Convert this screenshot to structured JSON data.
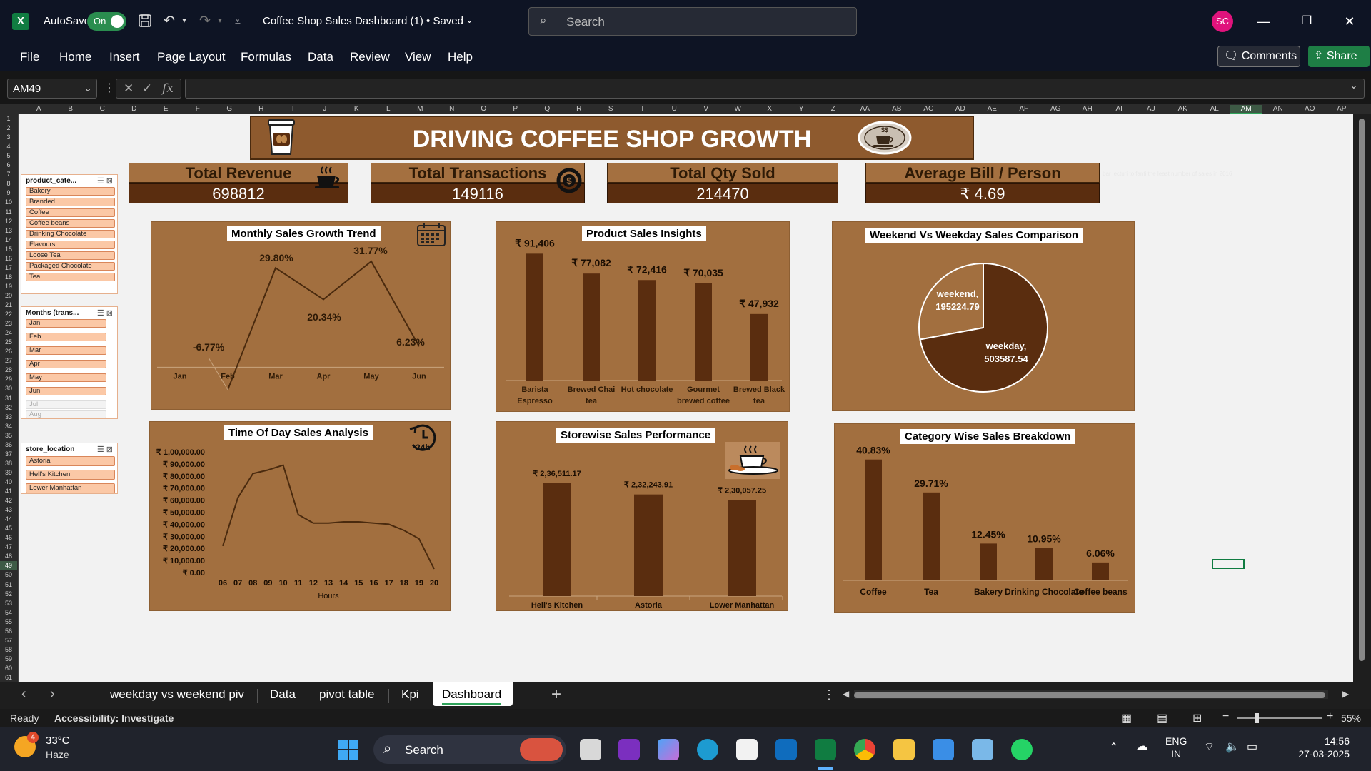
{
  "titlebar": {
    "autosave_label": "AutoSave",
    "autosave_state": "On",
    "doc_title": "Coffee Shop Sales Dashboard (1) • Saved",
    "search_placeholder": "Search",
    "avatar_initials": "SC"
  },
  "menu": [
    "File",
    "Home",
    "Insert",
    "Page Layout",
    "Formulas",
    "Data",
    "Review",
    "View",
    "Help"
  ],
  "comments_label": "Comments",
  "share_label": "Share",
  "formula_bar": {
    "name_box": "AM49",
    "formula": ""
  },
  "columns": [
    "A",
    "B",
    "C",
    "D",
    "E",
    "F",
    "G",
    "H",
    "I",
    "J",
    "K",
    "L",
    "M",
    "N",
    "O",
    "P",
    "Q",
    "R",
    "S",
    "T",
    "U",
    "V",
    "W",
    "X",
    "Y",
    "Z",
    "AA",
    "AB",
    "AC",
    "AD",
    "AE",
    "AF",
    "AG",
    "AH",
    "AI",
    "AJ",
    "AK",
    "AL",
    "AM",
    "AN",
    "AO",
    "AP"
  ],
  "selected_column": "AM",
  "selected_row": "49",
  "slicers": {
    "product_category": {
      "title": "product_cate...",
      "items": [
        "Bakery",
        "Branded",
        "Coffee",
        "Coffee beans",
        "Drinking Chocolate",
        "Flavours",
        "Loose Tea",
        "Packaged Chocolate",
        "Tea"
      ]
    },
    "months": {
      "title": "Months (trans...",
      "items": [
        "Jan",
        "Feb",
        "Mar",
        "Apr",
        "May",
        "Jun",
        "Jul",
        "Aug"
      ],
      "disabled": [
        "Jul",
        "Aug"
      ]
    },
    "store_location": {
      "title": "store_location",
      "items": [
        "Astoria",
        "Hell's Kitchen",
        "Lower Manhattan"
      ]
    }
  },
  "dashboard": {
    "banner_title": "DRIVING COFFEE SHOP GROWTH",
    "badge_text": "$$",
    "note": "bar lecturi to fanti the least number of sales in 2016",
    "kpis": [
      {
        "title": "Total Revenue",
        "value": "698812"
      },
      {
        "title": "Total Transactions",
        "value": "149116"
      },
      {
        "title": "Total Qty Sold",
        "value": "214470"
      },
      {
        "title": "Average Bill / Person",
        "value": "₹ 4.69"
      }
    ],
    "clock_label": "24h"
  },
  "chart_data": [
    {
      "type": "line",
      "title": "Monthly  Sales Growth Trend",
      "categories": [
        "Jan",
        "Feb",
        "Mar",
        "Apr",
        "May",
        "Jun"
      ],
      "values": [
        null,
        -6.77,
        29.8,
        20.34,
        31.77,
        6.23
      ],
      "data_labels": [
        "-6.77%",
        "29.80%",
        "20.34%",
        "31.77%",
        "6.23%"
      ],
      "ylim": [
        -10,
        35
      ]
    },
    {
      "type": "bar",
      "title": "Product Sales Insights",
      "categories": [
        "Barista Espresso",
        "Brewed Chai tea",
        "Hot chocolate",
        "Gourmet brewed coffee",
        "Brewed Black tea"
      ],
      "category_lines": [
        [
          "Barista",
          "Espresso"
        ],
        [
          "Brewed Chai",
          "tea"
        ],
        [
          "Hot chocolate"
        ],
        [
          "Gourmet",
          "brewed coffee"
        ],
        [
          "Brewed Black",
          "tea"
        ]
      ],
      "values": [
        91406,
        77082,
        72416,
        70035,
        47932
      ],
      "data_labels": [
        "₹ 91,406",
        "₹ 77,082",
        "₹ 72,416",
        "₹ 70,035",
        "₹ 47,932"
      ],
      "ylim": [
        0,
        100000
      ]
    },
    {
      "type": "pie",
      "title": "Weekend Vs Weekday Sales Comparison",
      "categories": [
        "weekend",
        "weekday"
      ],
      "values": [
        195224.79,
        503587.54
      ],
      "data_labels": [
        [
          "weekend,",
          "195224.79"
        ],
        [
          "weekday,",
          "503587.54"
        ]
      ]
    },
    {
      "type": "line",
      "title": "Time Of Day Sales Analysis",
      "categories": [
        "06",
        "07",
        "08",
        "09",
        "10",
        "11",
        "12",
        "13",
        "14",
        "15",
        "16",
        "17",
        "18",
        "19",
        "20"
      ],
      "values": [
        22000,
        62000,
        82000,
        85000,
        89000,
        48000,
        41000,
        41000,
        42000,
        42000,
        41000,
        40000,
        35000,
        28000,
        3000
      ],
      "xlabel": "Hours",
      "yticks": [
        "₹ 0.00",
        "₹ 10,000.00",
        "₹ 20,000.00",
        "₹ 30,000.00",
        "₹ 40,000.00",
        "₹ 50,000.00",
        "₹ 60,000.00",
        "₹ 70,000.00",
        "₹ 80,000.00",
        "₹ 90,000.00",
        "₹ 1,00,000.00"
      ],
      "ylim": [
        0,
        100000
      ]
    },
    {
      "type": "bar",
      "title": "Storewise Sales Performance",
      "categories": [
        "Hell's Kitchen",
        "Astoria",
        "Lower Manhattan"
      ],
      "values": [
        236511.17,
        232243.91,
        230057.25
      ],
      "data_labels": [
        "₹ 2,36,511.17",
        "₹ 2,32,243.91",
        "₹ 2,30,057.25"
      ]
    },
    {
      "type": "bar",
      "title": "Category Wise Sales Breakdown",
      "categories": [
        "Coffee",
        "Tea",
        "Bakery",
        "Drinking Chocolate",
        "Coffee beans"
      ],
      "values": [
        40.83,
        29.71,
        12.45,
        10.95,
        6.06
      ],
      "data_labels": [
        "40.83%",
        "29.71%",
        "12.45%",
        "10.95%",
        "6.06%"
      ],
      "ylim": [
        0,
        45
      ]
    }
  ],
  "sheet_tabs": [
    "weekday vs weekend piv",
    "Data",
    "pivot table",
    "Kpi",
    "Dashboard"
  ],
  "active_tab": "Dashboard",
  "status": {
    "ready": "Ready",
    "accessibility": "Accessibility: Investigate",
    "zoom": "55%"
  },
  "taskbar": {
    "temperature": "33°C",
    "condition": "Haze",
    "weather_badge": "4",
    "search_label": "Search",
    "language_1": "ENG",
    "language_2": "IN",
    "time": "14:56",
    "date": "27-03-2025"
  },
  "colors": {
    "card_brown": "#a26f3f",
    "bar_dark": "#5a2d0f",
    "excel_green": "#107c41",
    "title_bg": "#0e1424"
  }
}
